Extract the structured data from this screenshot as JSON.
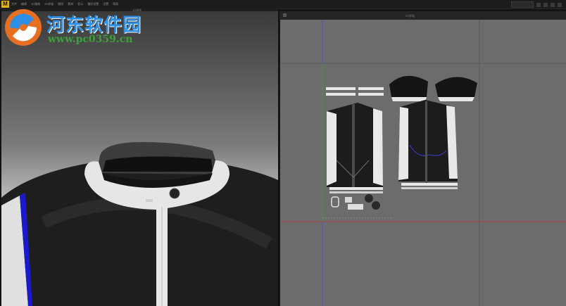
{
  "app": {
    "logo_letter": "M",
    "menu": [
      "文件",
      "编辑",
      "3D服装",
      "2D样板",
      "缝纫",
      "素材",
      "显示",
      "偏好设置",
      "设置",
      "帮助"
    ],
    "viewport_3d_label": "3D服装",
    "panel_2d_label": "2D样板"
  },
  "watermark": {
    "title": "河东软件园",
    "url": "www.pc0359.cn"
  },
  "colors": {
    "trim_blue": "#1a1acc",
    "panel_bg": "#6c6c6c",
    "axis_green": "#3a9a3a",
    "axis_red": "#b04040",
    "axis_blue": "#5050c0",
    "watermark_blue": "#2f8fe6",
    "watermark_green": "#3da23a"
  }
}
